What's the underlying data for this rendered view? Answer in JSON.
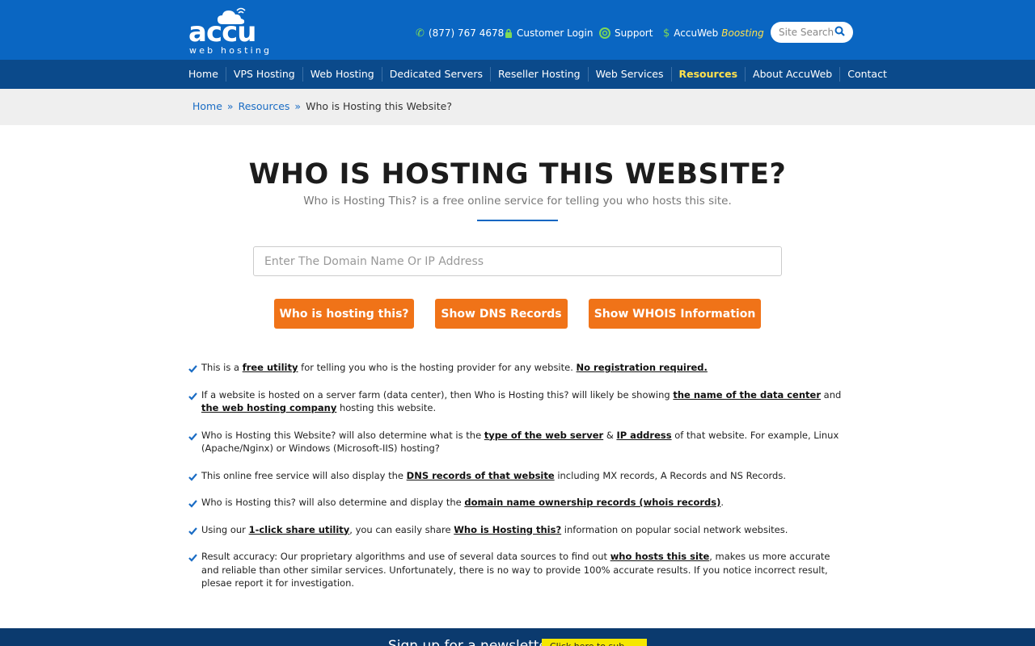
{
  "header": {
    "logo_word": "accu",
    "logo_sub": "web hosting",
    "phone": "(877) 767 4678",
    "customer_login": "Customer Login",
    "support": "Support",
    "accuweb": "AccuWeb",
    "boosting": "Boosting",
    "search_placeholder": "Site Search"
  },
  "nav": {
    "items": [
      "Home",
      "VPS Hosting",
      "Web Hosting",
      "Dedicated Servers",
      "Reseller Hosting",
      "Web Services",
      "Resources",
      "About AccuWeb",
      "Contact"
    ],
    "active": "Resources"
  },
  "breadcrumb": {
    "home": "Home",
    "sep": "»",
    "resources": "Resources",
    "current": "Who is Hosting this Website?"
  },
  "main": {
    "title": "WHO IS HOSTING THIS WEBSITE?",
    "subtitle": "Who is Hosting This? is a free online service for telling you who hosts this site.",
    "input_placeholder": "Enter The Domain Name Or IP Address",
    "btn_hosting": "Who is hosting this?",
    "btn_dns": "Show DNS Records",
    "btn_whois": "Show WHOIS Information"
  },
  "bullets": {
    "b1": {
      "t1": "This is a ",
      "k1": "free utility",
      "t2": " for telling you who is the hosting provider for any website. ",
      "k2": "No registration required."
    },
    "b2": {
      "t1": "If a website is hosted on a server farm (data center), then Who is Hosting this? will likely be showing ",
      "k1": "the name of the data center",
      "t2": " and ",
      "k2": "the web hosting company",
      "t3": " hosting this website."
    },
    "b3": {
      "t1": "Who is Hosting this Website? will also determine what is the ",
      "k1": "type of the web server",
      "t2": " & ",
      "k2": "IP address",
      "t3": " of that website. For example, Linux (Apache/Nginx) or Windows (Microsoft-IIS) hosting?"
    },
    "b4": {
      "t1": "This online free service will also display the ",
      "k1": "DNS records of that website",
      "t2": " including MX records, A Records and NS Records."
    },
    "b5": {
      "t1": "Who is Hosting this? will also determine and display the ",
      "k1": "domain name ownership records (whois records)",
      "t2": "."
    },
    "b6": {
      "t1": "Using our ",
      "k1": "1-click share utility",
      "t2": ", you can easily share ",
      "k2": "Who is Hosting this?",
      "t3": " information on popular social network websites."
    },
    "b7": {
      "t1": "Result accuracy: Our proprietary algorithms and use of several data sources to find out ",
      "k1": "who hosts this site",
      "t2": ", makes us more accurate and reliable than other similar services. Unfortunately, there is no way to provide 100% accurate results. If you notice incorrect result, plesae report it for investigation."
    }
  },
  "footer": {
    "newsletter": "Sign up for a newsletter",
    "button": "Click here to sub"
  },
  "colors": {
    "header_blue": "#0a66c2",
    "nav_blue": "#0b4a8b",
    "accent_orange": "#f07318",
    "active_yellow": "#ffe14d"
  }
}
